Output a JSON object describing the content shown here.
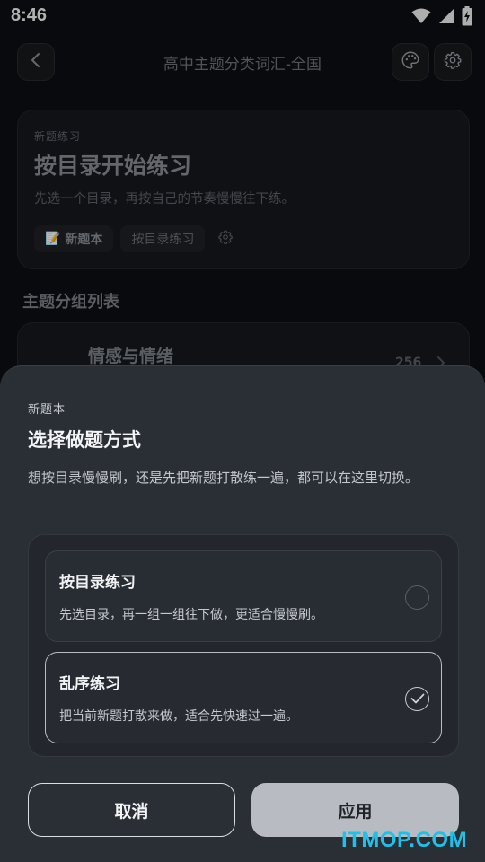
{
  "status_bar": {
    "time": "8:46"
  },
  "header": {
    "title": "高中主题分类词汇-全国"
  },
  "hero": {
    "eyebrow": "新题练习",
    "title": "按目录开始练习",
    "subtitle": "先选一个目录，再按自己的节奏慢慢往下练。",
    "chip_new_icon": "📝",
    "chip_new": "新题本",
    "chip_mode": "按目录练习"
  },
  "section_title": "主题分组列表",
  "group": {
    "name": "情感与情绪",
    "count": "256"
  },
  "sheet": {
    "eyebrow": "新题本",
    "title": "选择做题方式",
    "description": "想按目录慢慢刷，还是先把新题打散练一遍，都可以在这里切换。",
    "options": [
      {
        "title": "按目录练习",
        "description": "先选目录，再一组一组往下做，更适合慢慢刷。",
        "selected": false
      },
      {
        "title": "乱序练习",
        "description": "把当前新题打散来做，适合先快速过一遍。",
        "selected": true
      }
    ],
    "cancel_label": "取消",
    "apply_label": "应用"
  },
  "watermark": "ITMOP.COM",
  "colors": {
    "background": "#0d0f12",
    "sheet": "#2a2e35",
    "apply_button": "#b8bcc2",
    "watermark": "#1fc1e8"
  }
}
